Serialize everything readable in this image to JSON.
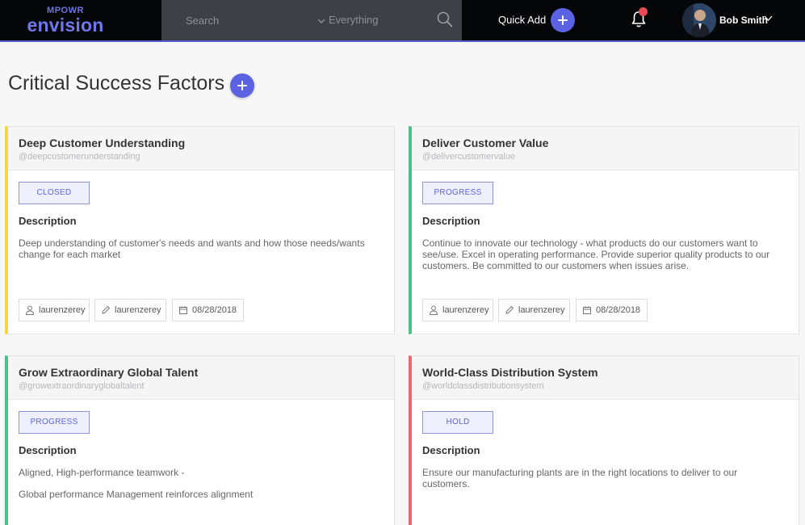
{
  "header": {
    "logo_small": "MPOWR",
    "logo_big": "envision",
    "search_placeholder": "Search",
    "search_scope": "Everything",
    "quick_add_label": "Quick Add",
    "user_name": "Bob Smith"
  },
  "page": {
    "title": "Critical Success Factors"
  },
  "colors": {
    "accent": "#5b63e3",
    "closed_border": "#f2d64b",
    "progress_border": "#4fbf8a",
    "hold_border": "#ea6a74"
  },
  "icons": {
    "search": "search-icon",
    "bell": "bell-icon",
    "user": "user-icon",
    "edit": "pencil-icon",
    "date": "calendar-icon"
  },
  "cards": [
    {
      "title": "Deep Customer Understanding",
      "handle": "@deepcustomerunderstanding",
      "status": "CLOSED",
      "description_label": "Description",
      "description": [
        "Deep understanding of customer's needs and wants and how those needs/wants change for each market"
      ],
      "owner": "laurenzerey",
      "editor": "laurenzerey",
      "date": "08/28/2018"
    },
    {
      "title": "Deliver Customer Value",
      "handle": "@delivercustomervalue",
      "status": "PROGRESS",
      "description_label": "Description",
      "description": [
        "Continue to innovate our technology - what products do our customers want to see/use. Excel in operating performance. Provide superior quality products to our customers. Be committed to our customers when issues arise."
      ],
      "owner": "laurenzerey",
      "editor": "laurenzerey",
      "date": "08/28/2018"
    },
    {
      "title": "Grow Extraordinary Global Talent",
      "handle": "@growextraordinaryglobaltalent",
      "status": "PROGRESS",
      "description_label": "Description",
      "description": [
        "Aligned, High-performance teamwork -",
        "Global performance Management reinforces alignment"
      ]
    },
    {
      "title": "World-Class Distribution System",
      "handle": "@worldclassdistributionsystem",
      "status": "HOLD",
      "description_label": "Description",
      "description": [
        "Ensure our manufacturing plants are in the right locations to deliver to our customers."
      ]
    }
  ]
}
